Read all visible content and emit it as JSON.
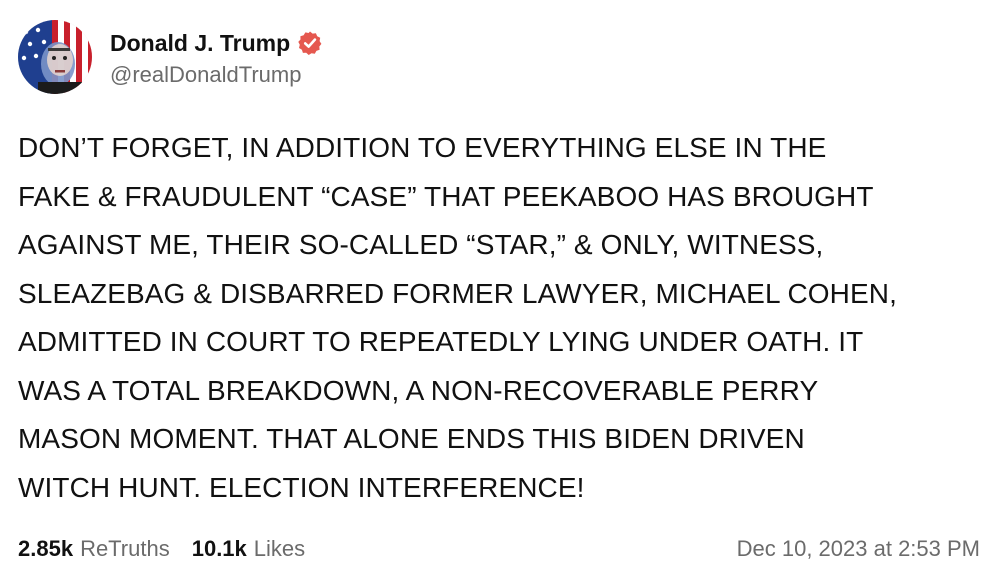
{
  "author": {
    "display_name": "Donald J. Trump",
    "handle": "@realDonaldTrump",
    "avatar_icon": "profile-photo-avatar",
    "verified_icon": "verified-badge-icon",
    "verified_color": "#e5584f"
  },
  "post": {
    "lines": [
      "DON’T FORGET, IN ADDITION TO EVERYTHING ELSE IN THE",
      "FAKE & FRAUDULENT “CASE” THAT PEEKABOO HAS BROUGHT",
      "AGAINST ME, THEIR SO-CALLED “STAR,” & ONLY, WITNESS,",
      "SLEAZEBAG & DISBARRED FORMER LAWYER, MICHAEL COHEN,",
      "ADMITTED IN COURT TO REPEATEDLY LYING UNDER OATH. IT",
      "WAS A TOTAL BREAKDOWN, A NON-RECOVERABLE PERRY",
      "MASON MOMENT. THAT ALONE ENDS THIS BIDEN DRIVEN",
      "WITCH HUNT. ELECTION INTERFERENCE!"
    ]
  },
  "stats": {
    "retruths_count": "2.85k",
    "retruths_label": "ReTruths",
    "likes_count": "10.1k",
    "likes_label": "Likes"
  },
  "timestamp": "Dec 10, 2023 at 2:53 PM"
}
